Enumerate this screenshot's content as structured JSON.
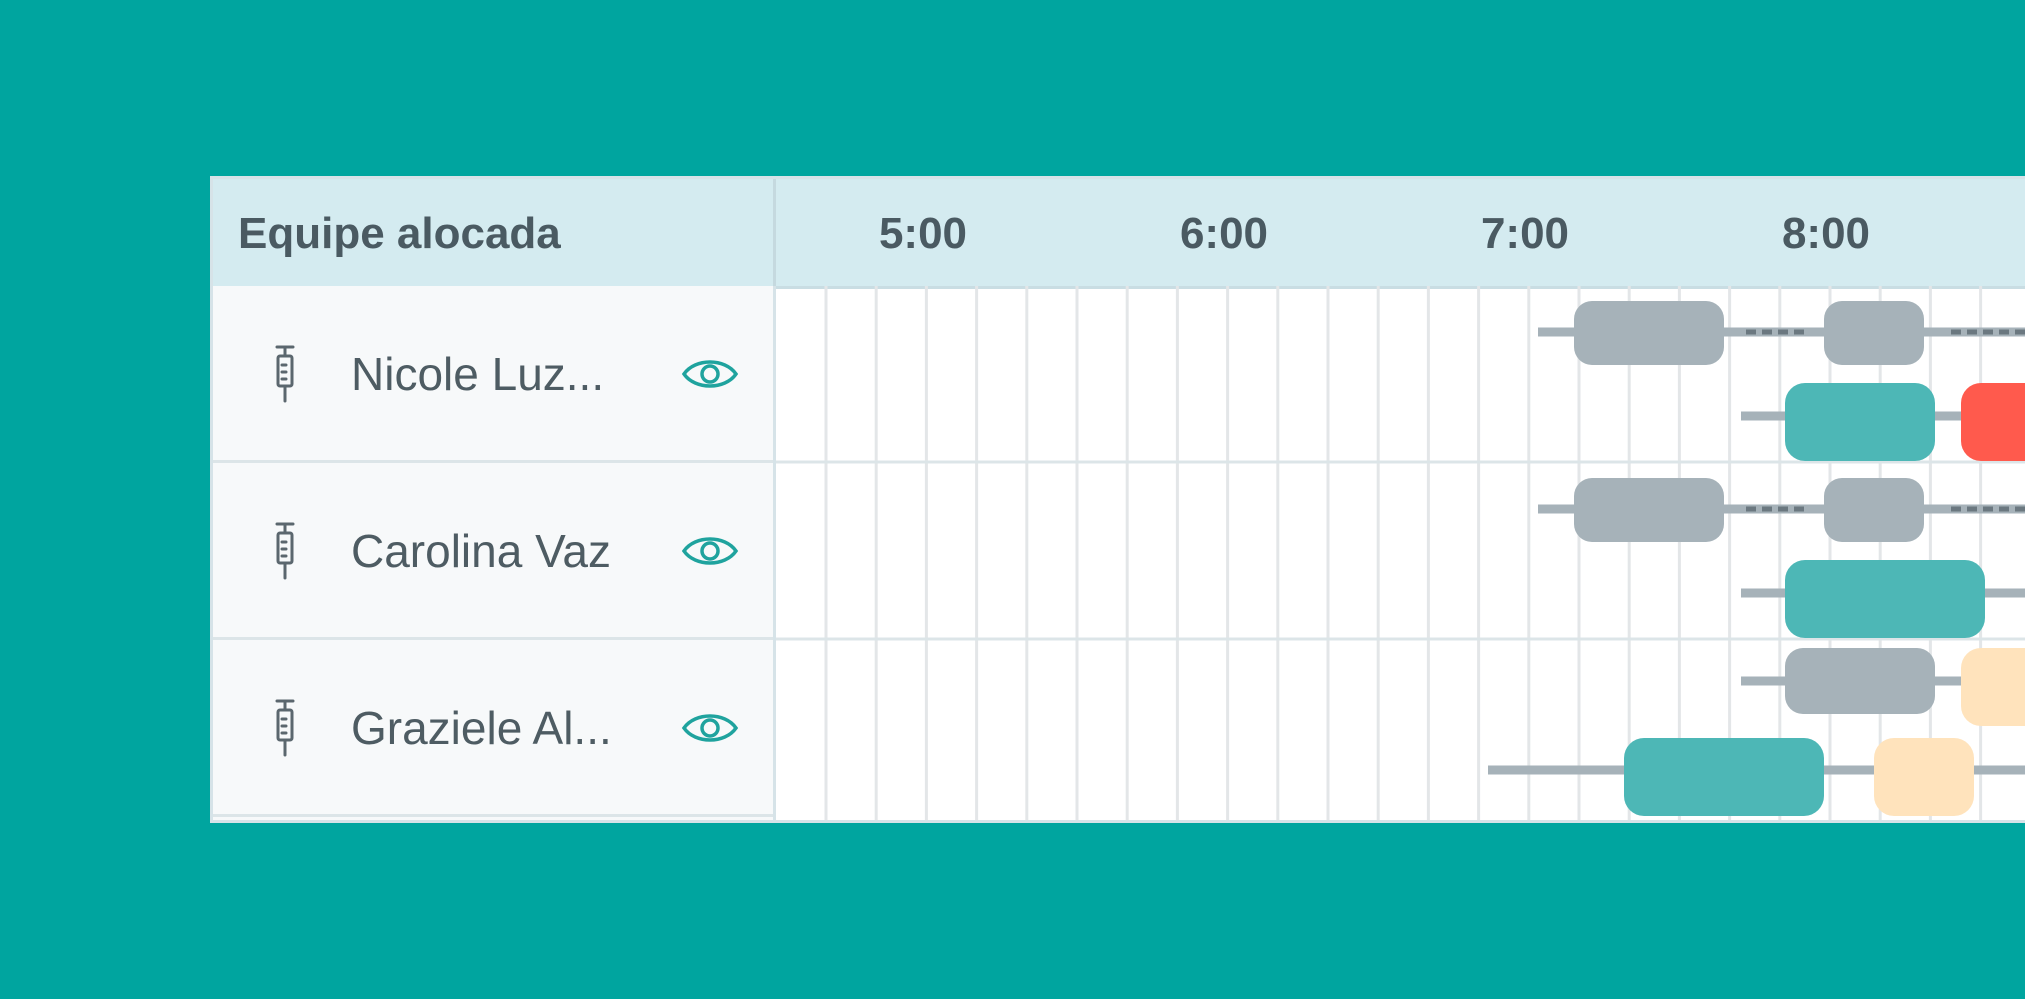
{
  "header": {
    "team_title": "Equipe alocada",
    "times": [
      "5:00",
      "6:00",
      "7:00",
      "8:00"
    ]
  },
  "team": [
    {
      "name": "Nicole Luz...",
      "icon": "syringe-icon",
      "action_icon": "eye-icon"
    },
    {
      "name": "Carolina Vaz",
      "icon": "syringe-icon",
      "action_icon": "eye-icon"
    },
    {
      "name": "Graziele Al...",
      "icon": "syringe-icon",
      "action_icon": "eye-icon"
    }
  ],
  "colors": {
    "background": "#00A59F",
    "header": "#D4EBF0",
    "accent": "#1FA39E",
    "gray_block": "#A6B2B9",
    "teal_block": "#4DB7B6",
    "red_block": "#FF5A4D",
    "peach_block": "#FFE3BC"
  }
}
